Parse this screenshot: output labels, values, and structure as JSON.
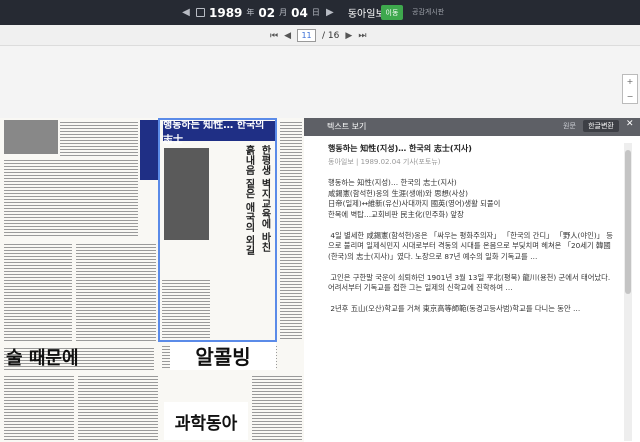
{
  "toolbar": {
    "year": "1989",
    "year_unit": "年",
    "month": "02",
    "month_unit": "月",
    "day": "04",
    "day_unit": "日",
    "newspaper": "동아일보",
    "go_label": "이동",
    "public_label": "공감게시판"
  },
  "pager": {
    "current_page": "11",
    "total_pages": "/ 16"
  },
  "zoom": {
    "plus": "+",
    "minus": "−"
  },
  "newspaper_page": {
    "headline": "행동하는 知性… 한국의 志士",
    "vertical_title": "한평생 벽지교육에 바친 흙내음 짙은 애국의 외길",
    "ad_1": "술 때문에",
    "ad_2": "알콜빙",
    "ad_3": "과학동아"
  },
  "text_panel": {
    "header": "텍스트 보기",
    "original_button": "원문",
    "translate_button": "한글변환",
    "close": "✕",
    "article_title": "행동하는 知性(지성)… 한국의 志士(지사)",
    "article_meta": "동아일보 | 1989.02.04 기사(포토뉴)",
    "body": "행동하는 知性(지성)… 한국의 志士(지사)\n咸錫憲(함석헌)옹의 生涯(생애)와 思想(사상)\n日帝(일제)↔維新(유신)사대까지 國英(영어)생활 되풀이\n한목에 벽탑…교회비판 民主化(민주화) 앞장\n\n 4일 별세한 咸錫憲(함석헌)옹은 「싸우는 평화주의자」 「한국의 간디」 「野人(야인)」 등으로 불리며 일제식민지 시대로부터 격동의 시대를 온몸으로 부딪치며 헤쳐온 「20세기 韓國(한국)의 志士(지사)」였다. 노장으로 87년 예수의 일화 기독교를 …\n\n 고인은 구한말 국운이 쇠퇴하던 1901년 3월 13일 平北(평북) 龍川(용천) 군에서 태어났다. 어려서부터 기독교를 접한 그는 일제의 신학교에 진학하여 …\n\n 2년후 五山(오산)학교를 거쳐 東京高等師範(동경고등사범)학교를 다니는 동안 …"
  }
}
